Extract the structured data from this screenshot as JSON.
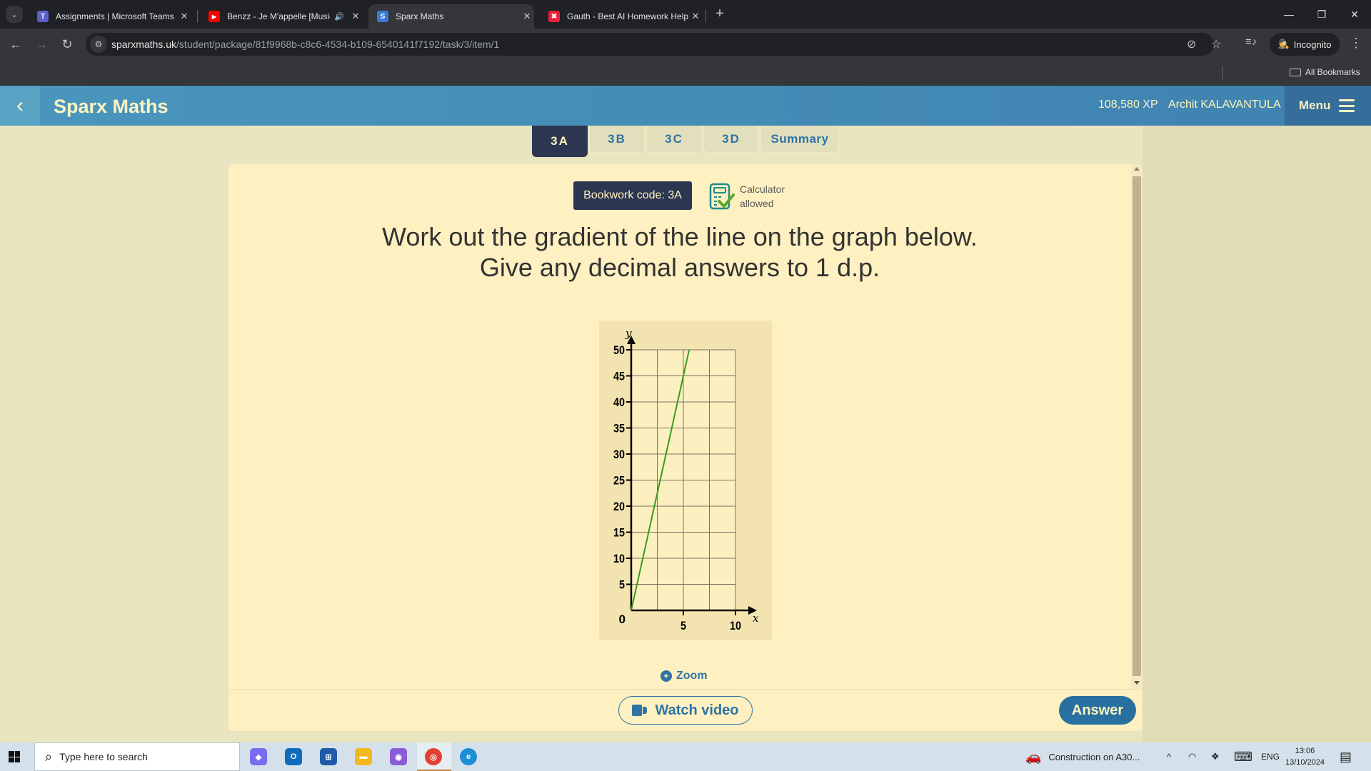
{
  "browser": {
    "tabs": [
      {
        "title": "Assignments | Microsoft Teams",
        "favicon": "teams-icon",
        "favicon_color": "#5b5fc7",
        "active": false
      },
      {
        "title": "Benzz - Je M'appelle [Music",
        "favicon": "youtube-icon",
        "favicon_color": "#ff0000",
        "active": false,
        "audio": true
      },
      {
        "title": "Sparx Maths",
        "favicon": "sparx-icon",
        "favicon_color": "#3a7bd5",
        "active": true
      },
      {
        "title": "Gauth - Best AI Homework Help",
        "favicon": "gauth-icon",
        "favicon_color": "#e8213a",
        "active": false
      }
    ],
    "favicon_letters": {
      "teams": "T",
      "youtube": "▶",
      "sparx": "S",
      "gauth": "✖"
    },
    "close_glyph": "✕",
    "speaker_glyph": "🔊",
    "newtab_glyph": "+",
    "tab_list_glyph": "⌄",
    "window_controls": {
      "minimize": "—",
      "restore": "❐",
      "close": "✕"
    },
    "nav": {
      "back": "←",
      "forward": "→",
      "reload": "↻"
    },
    "url": {
      "host": "sparxmaths.uk",
      "path": "/student/package/81f9968b-c8c6-4534-b109-6540141f7192/task/3/item/1"
    },
    "omnibox_icons": {
      "tune": "⚙",
      "eye_off": "⊘",
      "star": "☆",
      "media": "≡♪"
    },
    "incognito_label": "Incognito",
    "incognito_glyph": "🕵",
    "menu_glyph": "⋮",
    "bookmarks_label": "All Bookmarks"
  },
  "app": {
    "title": "Sparx Maths",
    "back_glyph": "‹",
    "xp": "108,580 XP",
    "user": "Archit KALAVANTULA",
    "menu_label": "Menu",
    "colors": {
      "header": "#3f82b0",
      "dark": "#2c3650",
      "accent": "#2e74a4",
      "cream": "#fff3bf",
      "card": "#fef0c1"
    },
    "part_tabs": [
      {
        "label": "3A",
        "active": true
      },
      {
        "label": "3B",
        "active": false
      },
      {
        "label": "3C",
        "active": false
      },
      {
        "label": "3D",
        "active": false
      },
      {
        "label": "Summary",
        "active": false
      }
    ],
    "bookwork_code": "Bookwork code: 3A",
    "calculator": {
      "line1": "Calculator",
      "line2": "allowed"
    },
    "question": {
      "line1": "Work out the gradient of the line on the graph below.",
      "line2": "Give any decimal answers to 1 d.p."
    },
    "zoom_label": "Zoom",
    "zoom_glyph": "+",
    "watch_video_label": "Watch video",
    "answer_label": "Answer"
  },
  "chart_data": {
    "type": "line",
    "title": "",
    "xlabel": "x",
    "ylabel": "y",
    "xlim": [
      0,
      10
    ],
    "ylim": [
      0,
      50
    ],
    "x_ticks": [
      0,
      5,
      10
    ],
    "x_tick_labels": [
      "5",
      "10"
    ],
    "origin_label": "0",
    "y_ticks": [
      5,
      10,
      15,
      20,
      25,
      30,
      35,
      40,
      45,
      50
    ],
    "y_tick_labels": [
      "5",
      "10",
      "15",
      "20",
      "25",
      "30",
      "35",
      "40",
      "45",
      "50"
    ],
    "grid": true,
    "grid_x_step": 2.5,
    "grid_y_step": 5,
    "series": [
      {
        "name": "line",
        "color": "#3a9a1e",
        "points": [
          [
            0,
            0
          ],
          [
            5.556,
            50
          ]
        ]
      }
    ]
  },
  "taskbar": {
    "search_placeholder": "Type here to search",
    "search_glyph": "⌕",
    "apps": [
      {
        "name": "copilot",
        "color": "#7a6cf0",
        "glyph": "◆"
      },
      {
        "name": "outlook",
        "color": "#0f6cbd",
        "glyph": "O"
      },
      {
        "name": "store",
        "color": "#1e5aa8",
        "glyph": "⊞"
      },
      {
        "name": "file-explorer",
        "color": "#f3b81c",
        "glyph": "▬"
      },
      {
        "name": "microsoft-365",
        "color": "#8a5cd6",
        "glyph": "◉"
      },
      {
        "name": "chrome",
        "color": "#e34133",
        "glyph": "◎"
      },
      {
        "name": "edge",
        "color": "#1a8fd6",
        "glyph": "e"
      }
    ],
    "notification": "Construction on A30...",
    "tray": {
      "chevron": "^",
      "wifi": "◠",
      "dropbox": "❖",
      "keyboard": "⌨",
      "lang": "ENG"
    },
    "time": "13:06",
    "date": "13/10/2024",
    "action_center_glyph": "▤"
  }
}
